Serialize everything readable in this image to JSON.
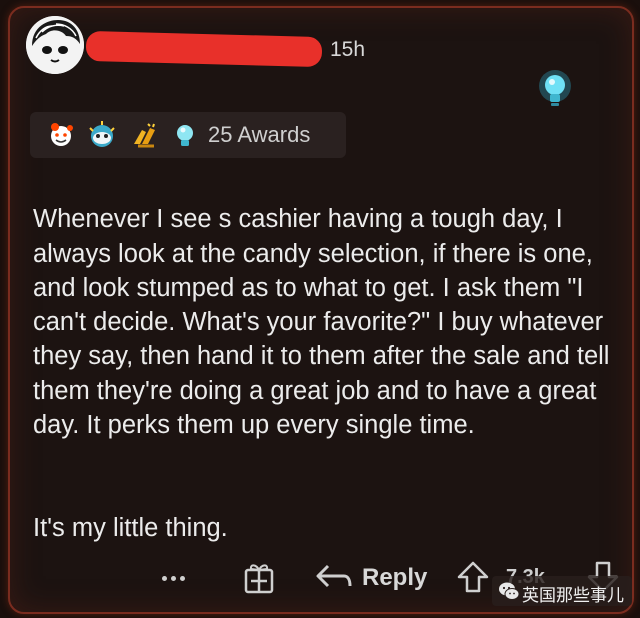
{
  "comment": {
    "timestamp": "15h",
    "awards_count_label": "25 Awards",
    "body_paragraphs": [
      "Whenever I see s cashier having a tough day, I always look at the candy selection, if there is one, and look stumped as to what to get. I ask them \"I can't decide. What's your favorite?\" I buy whatever they say, then hand it to them after the sale and tell them they're doing a great job and to have a great day. It perks them up every single time.",
      "It's my little thing."
    ]
  },
  "actions": {
    "reply_label": "Reply",
    "vote_count": "7.3k"
  },
  "watermark": {
    "text": "英国那些事儿"
  },
  "icons": {
    "avatar": "avatar-icon",
    "awards": [
      "wholesome-award-icon",
      "starstruck-award-icon",
      "gold-hands-award-icon",
      "helpful-award-icon"
    ],
    "pinned_award": "lightbulb-award-icon",
    "more": "more-options-icon",
    "gift": "give-award-icon",
    "reply": "reply-arrow-icon",
    "upvote": "upvote-arrow-icon",
    "downvote": "downvote-arrow-icon",
    "watermark": "wechat-logo-icon"
  },
  "colors": {
    "background": "#1c1311",
    "border": "#7a2c1f",
    "text": "#ececec",
    "redaction": "#e8302a"
  }
}
